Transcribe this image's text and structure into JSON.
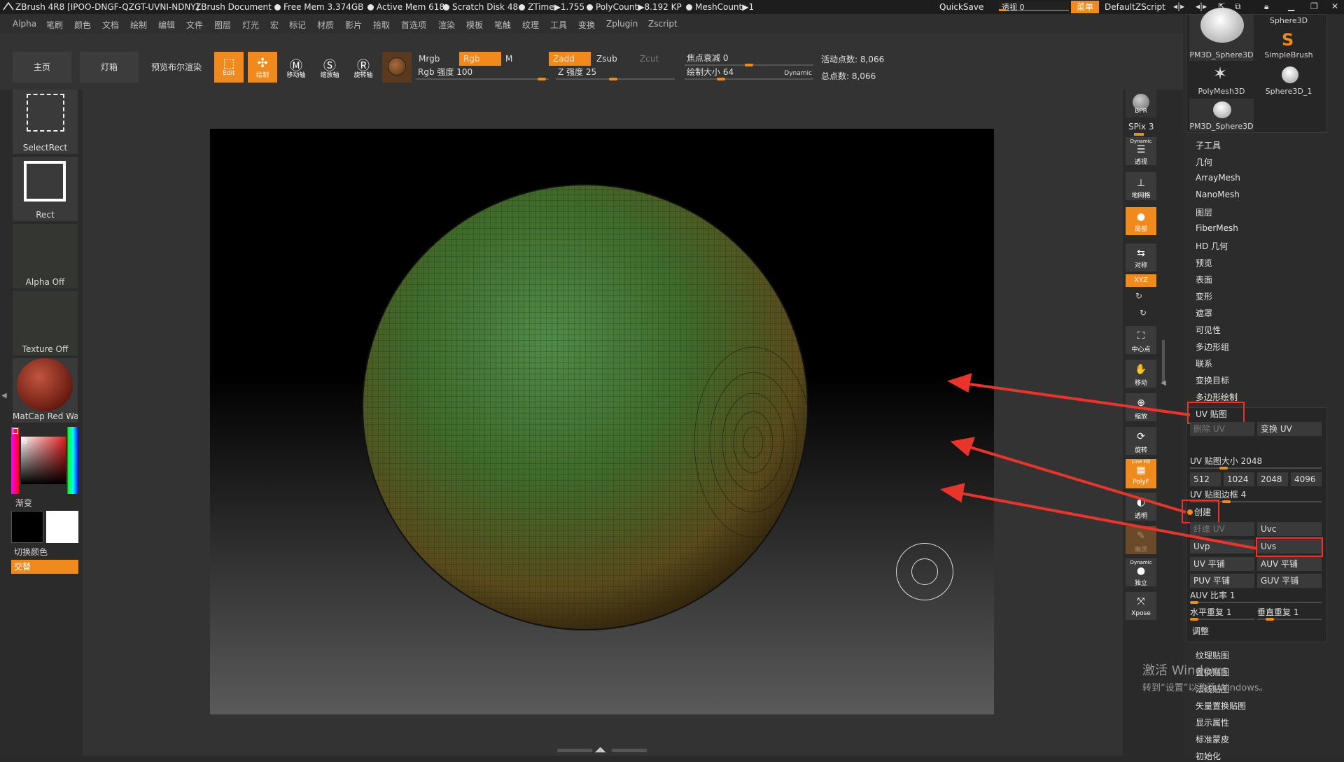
{
  "titlebar": {
    "app": "ZBrush 4R8 [IPOO-DNGF-QZGT-UVNI-NDNY]",
    "doc": "ZBrush Document",
    "free_mem": "Free Mem 3.374GB",
    "active_mem": "Active Mem 618",
    "scratch": "Scratch Disk 48",
    "ztime": "ZTime▶1.755",
    "polycount": "PolyCount▶8.192 KP",
    "meshcount": "MeshCount▶1",
    "quicksave": "QuickSave",
    "persp_label": "透视",
    "persp_value": "0",
    "menu_btn": "菜单",
    "script": "DefaultZScript"
  },
  "menus": [
    "Alpha",
    "笔刷",
    "颜色",
    "文档",
    "绘制",
    "编辑",
    "文件",
    "图层",
    "灯光",
    "宏",
    "标记",
    "材质",
    "影片",
    "拾取",
    "首选项",
    "渲染",
    "模板",
    "笔触",
    "纹理",
    "工具",
    "变换",
    "Zplugin",
    "Zscript"
  ],
  "shelf": {
    "home": "主页",
    "lightbox": "灯箱",
    "bool": "预览布尔渲染",
    "edit": "Edit",
    "draw": "绘制",
    "move": "移动轴",
    "scale": "缩放轴",
    "rotate": "旋转轴",
    "mrgb": "Mrgb",
    "rgb": "Rgb",
    "m": "M",
    "zadd": "Zadd",
    "zsub": "Zsub",
    "zcut": "Zcut",
    "rgb_intensity": "Rgb 强度 100",
    "z_intensity": "Z 强度 25",
    "focal": "焦点衰减 0",
    "draw_size": "绘制大小 64",
    "dynamic": "Dynamic",
    "active_points": "活动点数: 8,066",
    "total_points": "总点数: 8,066"
  },
  "left": {
    "select_rect": "SelectRect",
    "rect": "Rect",
    "alpha_off": "Alpha Off",
    "texture_off": "Texture Off",
    "matcap": "MatCap Red Wax",
    "gradient": "渐变",
    "switch_color": "切换颜色",
    "alternate": "交替"
  },
  "right_toolbar": {
    "bpr": "BPR",
    "spix": "SPix 3",
    "dynamic": "Dynamic",
    "persp": "透视",
    "floor": "地网格",
    "local": "局部",
    "sym": "对称",
    "xyz": "XYZ",
    "frame": "中心点",
    "move": "移动",
    "zoom": "缩放",
    "rotate": "旋转",
    "linefill": "Line Fill",
    "polyf": "PolyF",
    "transp": "透明",
    "ghost": "幽灵",
    "dynamic2": "Dynamic",
    "solo": "独立",
    "xpose": "Xpose"
  },
  "tool_thumbs": [
    "PM3D_Sphere3D",
    "SimpleBrush",
    "PolyMesh3D",
    "Sphere3D_1",
    "PM3D_Sphere3D",
    "Sphere3D"
  ],
  "palette": {
    "items_top": [
      "子工具",
      "几何",
      "ArrayMesh",
      "NanoMesh",
      "图层",
      "FiberMesh",
      "HD 几何",
      "预览",
      "表面",
      "变形",
      "遮罩",
      "可见性",
      "多边形组",
      "联系",
      "变换目标",
      "多边形绘制"
    ],
    "uv_map": "UV 贴图",
    "delete_uv": "删除 UV",
    "morph_uv": "变换 UV",
    "uv_size": "UV 贴图大小 2048",
    "sizes": [
      "512",
      "1024",
      "2048",
      "4096"
    ],
    "uv_border": "UV 贴图边框 4",
    "create": "创建",
    "fiber_uv": "纤维 UV",
    "uvc": "Uvc",
    "uvp": "Uvp",
    "uvs": "Uvs",
    "uv_tile": "UV 平铺",
    "auv_tile": "AUV 平铺",
    "puv_tile": "PUV 平铺",
    "guv_tile": "GUV 平铺",
    "auv_ratio": "AUV 比率 1",
    "h_repeat": "水平重复 1",
    "v_repeat": "垂直重复 1",
    "adjust": "调整",
    "items_bottom": [
      "纹理贴图",
      "置换贴图",
      "法线贴图",
      "矢量置换贴图",
      "显示属性",
      "标准蒙皮",
      "初始化"
    ]
  },
  "watermark": {
    "line1": "激活 Windows",
    "line2": "转到“设置”以激活 Windows。"
  },
  "colors": {
    "accent": "#f08a1c",
    "highlight_box": "#e8342a",
    "arrow": "#e8342a"
  }
}
